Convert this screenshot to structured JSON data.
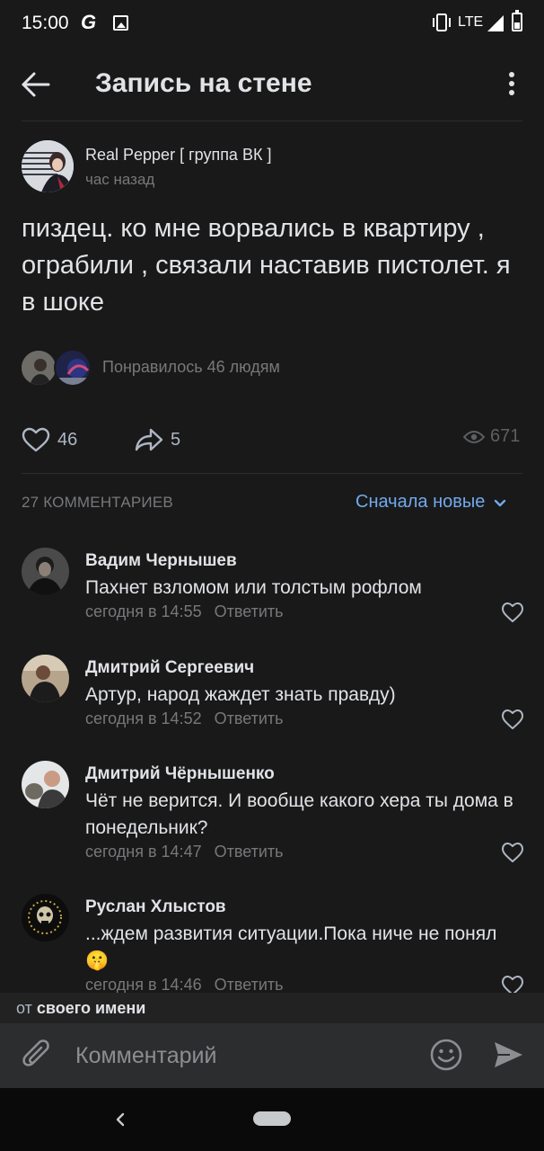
{
  "status_bar": {
    "time": "15:00",
    "app_icon": "G",
    "network": "LTE"
  },
  "header": {
    "title": "Запись на стене"
  },
  "post": {
    "author": "Real Pepper [ группа ВК ]",
    "time": "час назад",
    "text": "пиздец. ко мне ворвались в квартиру , ограбили , связали наставив пистолет. я в шоке",
    "likes_summary": "Понравилось 46 людям",
    "like_count": "46",
    "share_count": "5",
    "view_count": "671"
  },
  "comments_section": {
    "count_label": "27 КОММЕНТАРИЕВ",
    "sort_label": "Сначала новые"
  },
  "comments": [
    {
      "name": "Вадим Чернышев",
      "text": "Пахнет взломом или толстым рофлом",
      "time": "сегодня в 14:55",
      "reply": "Ответить"
    },
    {
      "name": "Дмитрий Сергеевич",
      "text": "Артур, народ жаждет знать правду)",
      "time": "сегодня в 14:52",
      "reply": "Ответить"
    },
    {
      "name": "Дмитрий Чёрнышенко",
      "text": "Чёт не верится. И вообще какого хера ты дома в понедельник?",
      "time": "сегодня в 14:47",
      "reply": "Ответить"
    },
    {
      "name": "Руслан Хлыстов",
      "text": "...ждем развития ситуации.Пока ниче не понял",
      "emoji": "🤫",
      "time": "сегодня в 14:46",
      "reply": "Ответить"
    }
  ],
  "composer": {
    "from_prefix": "от",
    "from_name": "своего имени",
    "placeholder": "Комментарий"
  },
  "colors": {
    "background": "#19191a",
    "accent": "#71aaeb",
    "secondary_text": "#76787a"
  },
  "icons": [
    "back-arrow-icon",
    "more-vertical-icon",
    "heart-icon",
    "share-icon",
    "eye-icon",
    "chevron-down-icon",
    "paperclip-icon",
    "smile-icon",
    "send-icon"
  ]
}
